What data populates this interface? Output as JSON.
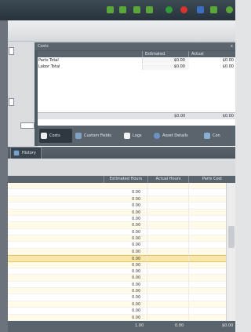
{
  "toolbar": {
    "icons": [
      {
        "name": "checkmark-icon",
        "color": "#5aa83a"
      },
      {
        "name": "arrow-right-icon",
        "color": "#5aa83a"
      },
      {
        "name": "arrow-left-icon",
        "color": "#5aa83a"
      },
      {
        "name": "arrow-up-icon",
        "color": "#5aa83a"
      },
      {
        "name": "add-icon",
        "color": "#2f9a38"
      },
      {
        "name": "delete-icon",
        "color": "#d9342b"
      },
      {
        "name": "save-icon",
        "color": "#3d6fc0"
      },
      {
        "name": "undo-icon",
        "color": "#5aa83a"
      },
      {
        "name": "refresh-icon",
        "color": "#5aa83a"
      }
    ]
  },
  "costs": {
    "title": "Costs",
    "close": "x",
    "columns": [
      "",
      "Estimated",
      "Actual"
    ],
    "rows": [
      {
        "label": "Parts Total",
        "estimated": "$0.00",
        "actual": "$0.00"
      },
      {
        "label": "Labor Total",
        "estimated": "$0.00",
        "actual": "$0.00"
      }
    ],
    "totals": {
      "estimated": "$0.00",
      "actual": "$0.00"
    }
  },
  "tabs": [
    {
      "label": "Costs",
      "icon": "costs-icon",
      "active": true
    },
    {
      "label": "Custom Fields",
      "icon": "custom-fields-icon",
      "active": false
    },
    {
      "label": "Logs",
      "icon": "logs-icon",
      "active": false
    },
    {
      "label": "Asset Details",
      "icon": "asset-details-icon",
      "active": false
    },
    {
      "label": "Con",
      "icon": "contacts-icon",
      "active": false
    }
  ],
  "history": {
    "tab_label": "History",
    "columns": [
      "Estimated Hours",
      "Actual Hours",
      "Parts Cost"
    ],
    "rows": [
      "",
      "0.00",
      "0.00",
      "0.00",
      "0.00",
      "0.00",
      "0.00",
      "0.00",
      "0.00",
      "0.00",
      "0.00",
      "0.00",
      "0.00",
      "0.00",
      "0.00",
      "0.00",
      "0.00",
      "0.00",
      "0.00",
      "0.00",
      "0.00"
    ],
    "totals": {
      "estimated": "1.00",
      "actual": "0.00",
      "parts": "$0.00"
    }
  }
}
